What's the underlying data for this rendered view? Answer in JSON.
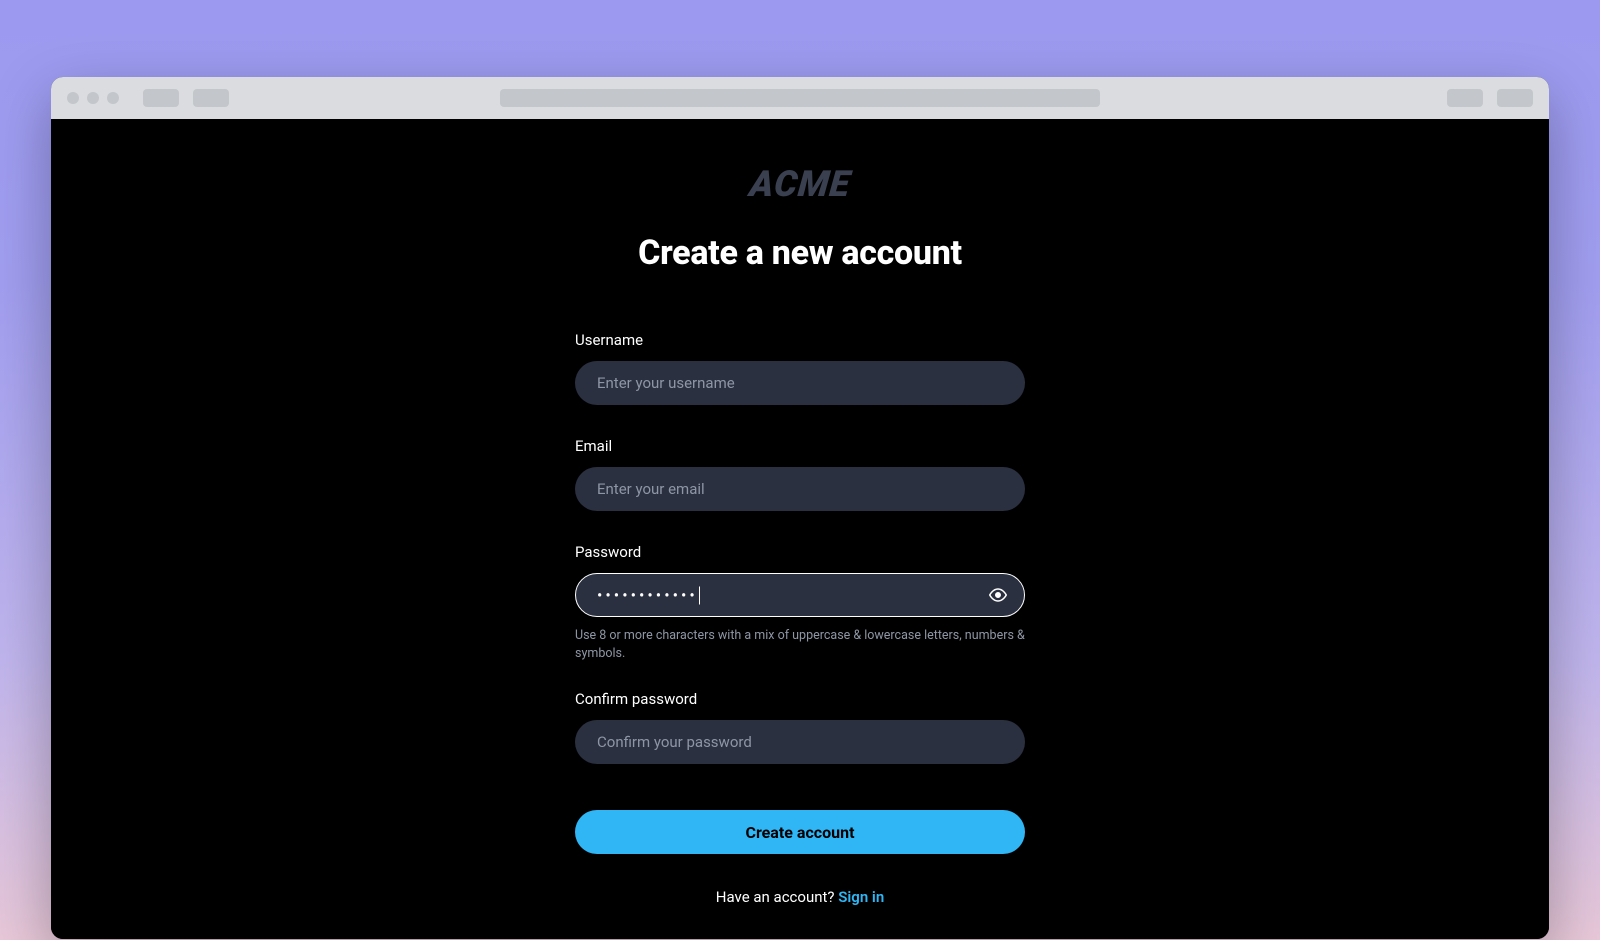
{
  "logo": "ACME",
  "title": "Create a new account",
  "form": {
    "username": {
      "label": "Username",
      "placeholder": "Enter your username",
      "value": ""
    },
    "email": {
      "label": "Email",
      "placeholder": "Enter your email",
      "value": ""
    },
    "password": {
      "label": "Password",
      "placeholder": "",
      "value": "••••••••••••",
      "hint": "Use 8 or more characters with a mix of uppercase & lowercase letters, numbers & symbols."
    },
    "confirm_password": {
      "label": "Confirm password",
      "placeholder": "Confirm your password",
      "value": ""
    },
    "submit_label": "Create account"
  },
  "footer": {
    "prompt": "Have an account? ",
    "link_label": "Sign in"
  }
}
